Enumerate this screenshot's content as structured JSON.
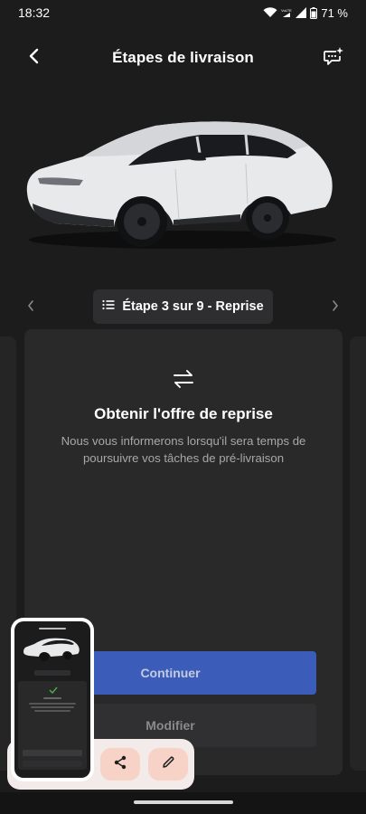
{
  "status": {
    "time": "18:32",
    "battery_pct": "71 %",
    "volte": "VoLTE"
  },
  "header": {
    "title": "Étapes de livraison"
  },
  "step_nav": {
    "label": "Étape 3 sur 9 - Reprise"
  },
  "card": {
    "title": "Obtenir l'offre de reprise",
    "description": "Nous vous informerons lorsqu'il sera temps de poursuivre vos tâches de pré-livraison",
    "primary_button": "Continuer",
    "secondary_button": "Modifier"
  },
  "colors": {
    "background": "#1c1c1d",
    "card": "#29292a",
    "primary_button": "#3b5cb8",
    "overlay": "#f3ebe9",
    "overlay_button": "#f7d2c6"
  },
  "icons": {
    "back": "chevron-left-icon",
    "chat": "chat-sparkle-icon",
    "list": "list-icon",
    "swap": "swap-arrows-icon",
    "share": "share-icon",
    "edit": "pencil-icon"
  }
}
